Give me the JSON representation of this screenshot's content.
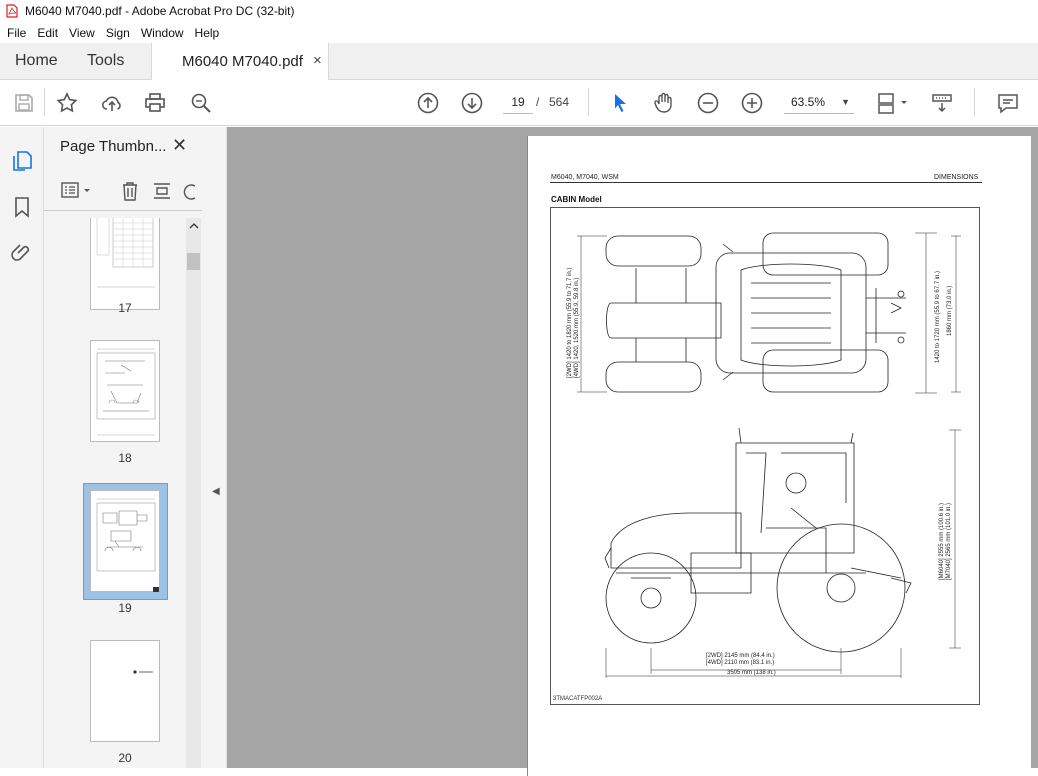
{
  "window": {
    "title": "M6040 M7040.pdf - Adobe Acrobat Pro DC (32-bit)"
  },
  "menu": [
    "File",
    "Edit",
    "View",
    "Sign",
    "Window",
    "Help"
  ],
  "tabs": {
    "home": "Home",
    "tools": "Tools",
    "document": "M6040 M7040.pdf",
    "close": "×"
  },
  "toolbar": {
    "current_page": "19",
    "separator": "/",
    "page_count": "564",
    "zoom": "63.5%",
    "icons": [
      "save-icon",
      "star-icon",
      "upload-icon",
      "print-icon",
      "search-zoom-icon",
      "page-up-icon",
      "page-down-icon",
      "select-arrow-icon",
      "hand-icon",
      "zoom-out-icon",
      "zoom-in-icon",
      "page-fit-icon",
      "scroll-mode-icon",
      "comment-icon"
    ]
  },
  "panel": {
    "title": "Page Thumbn...",
    "close": "✕",
    "thumbnails": [
      {
        "label": "17"
      },
      {
        "label": "18"
      },
      {
        "label": "19",
        "selected": true
      },
      {
        "label": "20"
      }
    ]
  },
  "document_page": {
    "header_left": "M6040, M7040, WSM",
    "header_right": "DIMENSIONS",
    "section": "CABIN Model",
    "figure_code": "3TMACATFP002A",
    "dims": {
      "rear_track_2wd": "[2WD] 1420 to 1820 mm (55.9 to 71.7 in.)",
      "rear_track_4wd": "[4WD] 1420, 1520 mm (55.9, 59.8 in.)",
      "front_track": "1420 to 1720 mm (55.9 to 67.7 in.)",
      "overall_width": "1860 mm (73.0 in.)",
      "height_m6040": "[M6040] 2555 mm (100.6 in.)",
      "height_m7040": "[M7040] 2565 mm (101.0 in.)",
      "wheelbase_2wd": "[2WD] 2145 mm (84.4 in.)",
      "wheelbase_4wd": "[4WD] 2110 mm (83.1 in.)",
      "overall_length": "3505 mm (138 in.)"
    }
  },
  "colors": {
    "canvas": "#a5a5a5",
    "panel": "#f4f4f4",
    "accent": "#1473e6",
    "pdf_red": "#e21d1d",
    "selection": "#9cc3e5"
  }
}
